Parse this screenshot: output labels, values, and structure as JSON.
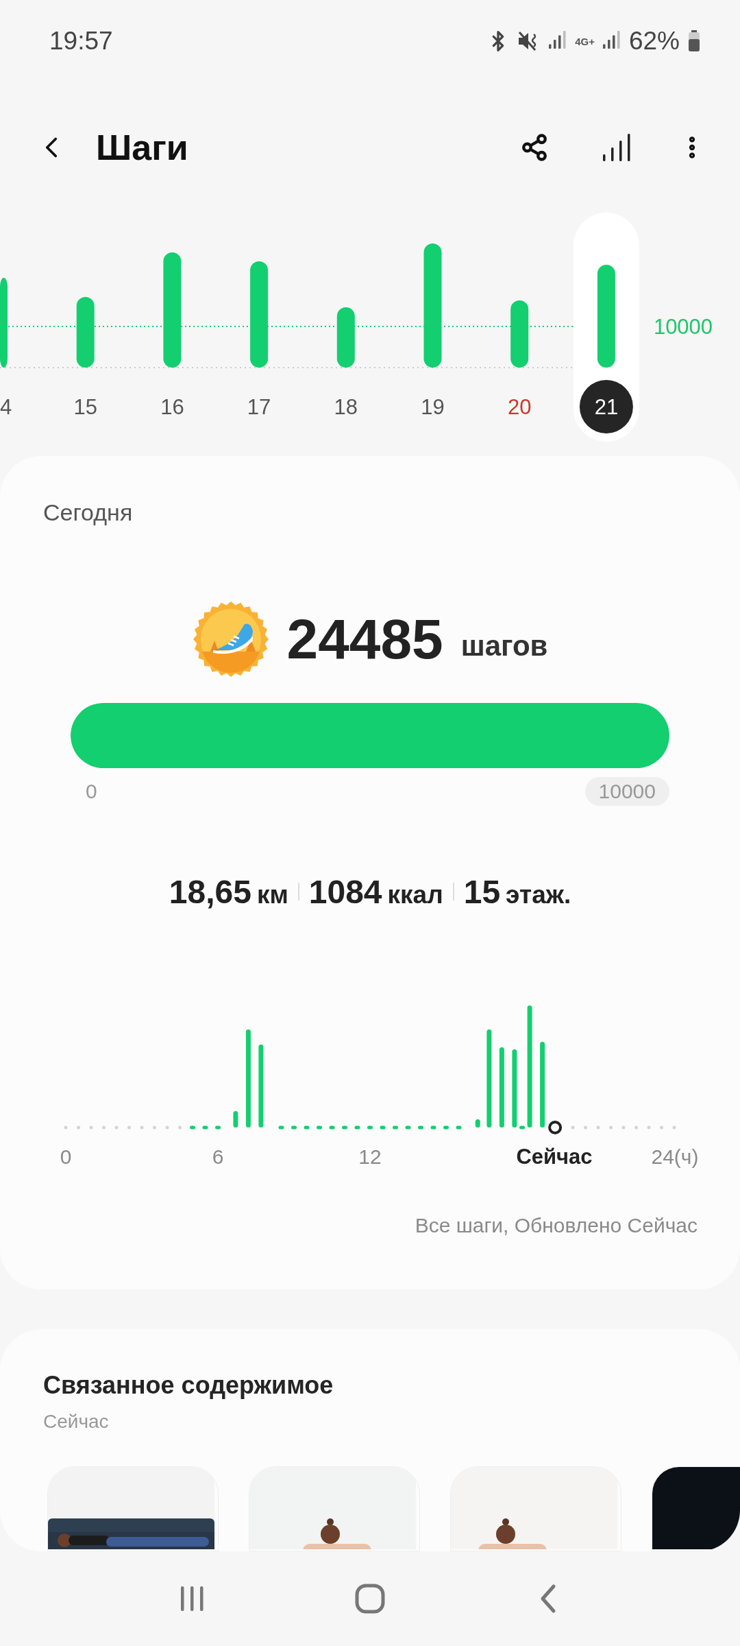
{
  "status_bar": {
    "time": "19:57",
    "network": "4G+",
    "battery": "62%"
  },
  "header": {
    "title": "Шаги"
  },
  "week": {
    "goal": "10000",
    "days": [
      {
        "label": "4",
        "selected": false,
        "weekend": false
      },
      {
        "label": "15",
        "selected": false,
        "weekend": false
      },
      {
        "label": "16",
        "selected": false,
        "weekend": false
      },
      {
        "label": "17",
        "selected": false,
        "weekend": false
      },
      {
        "label": "18",
        "selected": false,
        "weekend": false
      },
      {
        "label": "19",
        "selected": false,
        "weekend": false
      },
      {
        "label": "20",
        "selected": false,
        "weekend": true
      },
      {
        "label": "21",
        "selected": true,
        "weekend": false
      }
    ]
  },
  "today": {
    "title": "Сегодня",
    "steps": "24485",
    "unit": "шагов",
    "progress": {
      "level": 1,
      "min": "0",
      "max": "10000"
    },
    "stats": [
      {
        "value": "18,65",
        "unit": "км"
      },
      {
        "value": "1084",
        "unit": "ккал"
      },
      {
        "value": "15",
        "unit": "этаж."
      }
    ],
    "hourly_axis": [
      {
        "label": "0",
        "kind": "hour"
      },
      {
        "label": "6",
        "kind": "hour"
      },
      {
        "label": "12",
        "kind": "hour"
      },
      {
        "label": "Сейчас",
        "kind": "now"
      },
      {
        "label": "24(ч)",
        "kind": "hour"
      }
    ],
    "footnote": "Все шаги, Обновлено Сейчас"
  },
  "related": {
    "title": "Связанное содержимое",
    "subtitle": "Сейчас"
  }
}
